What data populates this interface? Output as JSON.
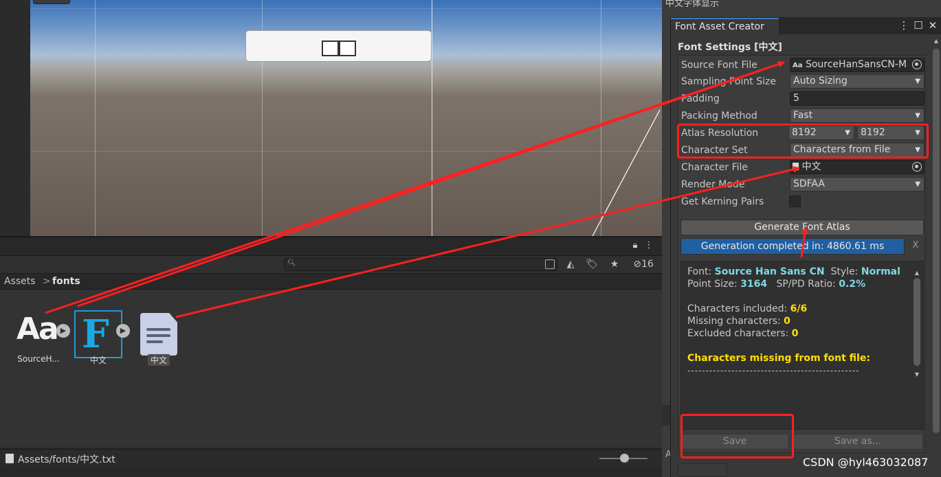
{
  "top_window_title": "中文字体显示",
  "project": {
    "hidden_count": "16",
    "breadcrumb": {
      "root": "Assets",
      "separator": ">",
      "current": "fonts"
    },
    "assets": [
      {
        "label": "SourceH...",
        "icon_glyph": "Aa",
        "icon": "font-file-icon"
      },
      {
        "label": "中文",
        "icon_glyph": "F",
        "icon": "font-asset-icon"
      },
      {
        "label": "中文",
        "icon": "text-file-icon"
      }
    ],
    "status_path": "Assets/fonts/中文.txt"
  },
  "font_asset_creator": {
    "tab_title": "Font Asset Creator",
    "heading": "Font Settings [中文]",
    "fields": {
      "source_font_file": {
        "label": "Source Font File",
        "icon_glyph": "Aa",
        "value": "SourceHanSansCN-M"
      },
      "sampling_point_size": {
        "label": "Sampling Point Size",
        "value": "Auto Sizing"
      },
      "padding": {
        "label": "Padding",
        "value": "5"
      },
      "packing_method": {
        "label": "Packing Method",
        "value": "Fast"
      },
      "atlas_resolution": {
        "label": "Atlas Resolution",
        "width": "8192",
        "height": "8192"
      },
      "character_set": {
        "label": "Character Set",
        "value": "Characters from File"
      },
      "character_file": {
        "label": "Character File",
        "value": "中文"
      },
      "render_mode": {
        "label": "Render Mode",
        "value": "SDFAA"
      },
      "get_kerning_pairs": {
        "label": "Get Kerning Pairs",
        "checked": false
      }
    },
    "generate_button": "Generate Font Atlas",
    "progress": {
      "text": "Generation completed in: 4860.61 ms",
      "fraction": 1.0,
      "cancel": "X"
    },
    "info": {
      "font_label": "Font:",
      "font_value": "Source Han Sans CN",
      "style_label": "Style:",
      "style_value": "Normal",
      "point_size_label": "Point Size:",
      "point_size_value": "3164",
      "ratio_label": "SP/PD Ratio:",
      "ratio_value": "0.2%",
      "included_label": "Characters included:",
      "included_value": "6/6",
      "missing_label": "Missing characters:",
      "missing_value": "0",
      "excluded_label": "Excluded characters:",
      "excluded_value": "0",
      "missing_header": "Characters missing from font file:",
      "separator": "-----------------------------------------------"
    },
    "save_button": "Save",
    "save_as_button": "Save as..."
  },
  "colors": {
    "annotation_red": "#ff2020",
    "progress_blue": "#1f5fa2",
    "cyan_value": "#7fd8e8",
    "yellow_value": "#ffe000",
    "selection_blue": "#1f9ae0"
  },
  "watermark": "CSDN @hyl463032087"
}
